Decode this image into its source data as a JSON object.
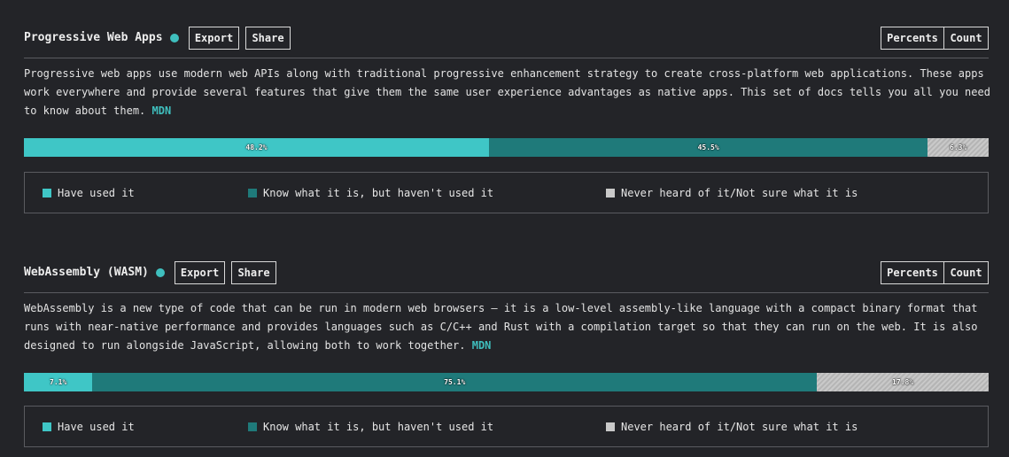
{
  "colors": {
    "have_used": "#3fc6c6",
    "know": "#1f7a7a",
    "never": "#c9c9c9",
    "accent": "#3fbfbe",
    "background": "#232428"
  },
  "sections": [
    {
      "title": "Progressive Web Apps",
      "export_label": "Export",
      "share_label": "Share",
      "percents_label": "Percents",
      "count_label": "Count",
      "description": "Progressive web apps use modern web APIs along with traditional progressive enhancement strategy to create cross-platform web applications. These apps work everywhere and provide several features that give them the same user experience advantages as native apps. This set of docs tells you all you need to know about them.",
      "link_label": "MDN",
      "bar": [
        {
          "label": "48.2%",
          "value": 48.2
        },
        {
          "label": "45.5%",
          "value": 45.5
        },
        {
          "label": "6.3%",
          "value": 6.3
        }
      ],
      "legend": [
        "Have used it",
        "Know what it is, but haven't used it",
        "Never heard of it/Not sure what it is"
      ]
    },
    {
      "title": "WebAssembly (WASM)",
      "export_label": "Export",
      "share_label": "Share",
      "percents_label": "Percents",
      "count_label": "Count",
      "description": "WebAssembly is a new type of code that can be run in modern web browsers — it is a low-level assembly-like language with a compact binary format that runs with near-native performance and provides languages such as C/C++ and Rust with a compilation target so that they can run on the web. It is also designed to run alongside JavaScript, allowing both to work together.",
      "link_label": "MDN",
      "bar": [
        {
          "label": "7.1%",
          "value": 7.1
        },
        {
          "label": "75.1%",
          "value": 75.1
        },
        {
          "label": "17.8%",
          "value": 17.8
        }
      ],
      "legend": [
        "Have used it",
        "Know what it is, but haven't used it",
        "Never heard of it/Not sure what it is"
      ]
    }
  ]
}
